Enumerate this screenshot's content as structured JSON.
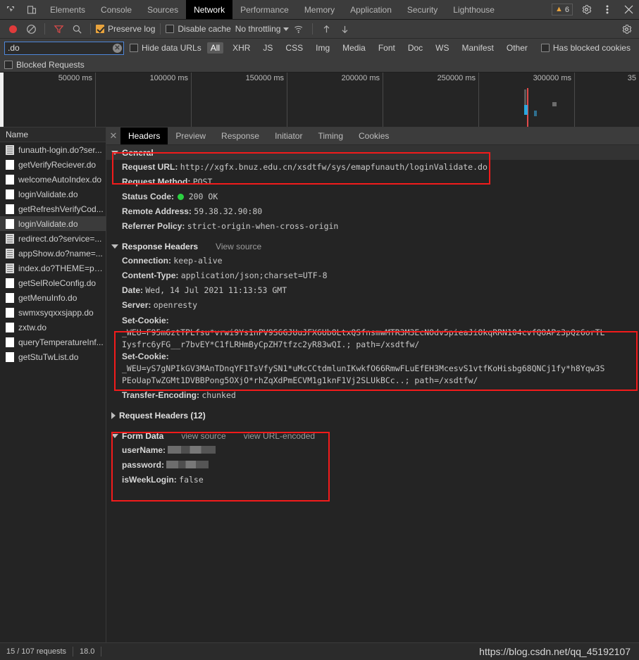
{
  "devtools": {
    "panel_tabs": [
      {
        "label": "Elements",
        "active": false
      },
      {
        "label": "Console",
        "active": false
      },
      {
        "label": "Sources",
        "active": false
      },
      {
        "label": "Network",
        "active": true
      },
      {
        "label": "Performance",
        "active": false
      },
      {
        "label": "Memory",
        "active": false
      },
      {
        "label": "Application",
        "active": false
      },
      {
        "label": "Security",
        "active": false
      },
      {
        "label": "Lighthouse",
        "active": false
      }
    ],
    "warning_count": "6",
    "icons": {
      "inspect": "inspect-element-icon",
      "device": "device-toolbar-icon",
      "settings": "gear-icon",
      "more": "kebab-menu-icon",
      "close": "close-icon"
    }
  },
  "toolbar": {
    "record_title": "record-button",
    "clear_title": "clear-button",
    "filter_title": "filter-button",
    "search_title": "search-button",
    "preserve_log_label": "Preserve log",
    "preserve_log_checked": true,
    "disable_cache_label": "Disable cache",
    "disable_cache_checked": false,
    "throttling_label": "No throttling",
    "wifi_title": "network-conditions-icon",
    "upload_title": "import-har-icon",
    "download_title": "export-har-icon",
    "settings_title": "network-settings-icon"
  },
  "filter_bar": {
    "filter_value": ".do",
    "filter_placeholder": "Filter",
    "hide_data_urls_label": "Hide data URLs",
    "hide_data_urls_checked": false,
    "types": [
      {
        "label": "All",
        "active": true
      },
      {
        "label": "XHR",
        "active": false
      },
      {
        "label": "JS",
        "active": false
      },
      {
        "label": "CSS",
        "active": false
      },
      {
        "label": "Img",
        "active": false
      },
      {
        "label": "Media",
        "active": false
      },
      {
        "label": "Font",
        "active": false
      },
      {
        "label": "Doc",
        "active": false
      },
      {
        "label": "WS",
        "active": false
      },
      {
        "label": "Manifest",
        "active": false
      },
      {
        "label": "Other",
        "active": false
      }
    ],
    "has_blocked_cookies_label": "Has blocked cookies",
    "has_blocked_cookies_checked": false,
    "blocked_requests_label": "Blocked Requests",
    "blocked_requests_checked": false
  },
  "overview": {
    "ticks": [
      "50000 ms",
      "100000 ms",
      "150000 ms",
      "200000 ms",
      "250000 ms",
      "300000 ms",
      "35"
    ]
  },
  "request_list": {
    "header": "Name",
    "rows": [
      {
        "name": "funauth-login.do?ser...",
        "type": "doc",
        "selected": false
      },
      {
        "name": "getVerifyReciever.do",
        "type": "xhr",
        "selected": false
      },
      {
        "name": "welcomeAutoIndex.do",
        "type": "xhr",
        "selected": false
      },
      {
        "name": "loginValidate.do",
        "type": "xhr",
        "selected": false
      },
      {
        "name": "getRefreshVerifyCod...",
        "type": "xhr",
        "selected": false
      },
      {
        "name": "loginValidate.do",
        "type": "xhr",
        "selected": true
      },
      {
        "name": "redirect.do?service=...",
        "type": "doc",
        "selected": false
      },
      {
        "name": "appShow.do?name=...",
        "type": "doc",
        "selected": false
      },
      {
        "name": "index.do?THEME=pu...",
        "type": "doc",
        "selected": false
      },
      {
        "name": "getSelRoleConfig.do",
        "type": "xhr",
        "selected": false
      },
      {
        "name": "getMenuInfo.do",
        "type": "xhr",
        "selected": false
      },
      {
        "name": "swmxsyqxxsjapp.do",
        "type": "xhr",
        "selected": false
      },
      {
        "name": "zxtw.do",
        "type": "xhr",
        "selected": false
      },
      {
        "name": "queryTemperatureInf...",
        "type": "xhr",
        "selected": false
      },
      {
        "name": "getStuTwList.do",
        "type": "xhr",
        "selected": false
      }
    ]
  },
  "detail_tabs": [
    {
      "label": "Headers",
      "active": true
    },
    {
      "label": "Preview",
      "active": false
    },
    {
      "label": "Response",
      "active": false
    },
    {
      "label": "Initiator",
      "active": false
    },
    {
      "label": "Timing",
      "active": false
    },
    {
      "label": "Cookies",
      "active": false
    }
  ],
  "headers": {
    "general": {
      "title": "General",
      "rows": [
        {
          "key": "Request URL:",
          "value": "http://xgfx.bnuz.edu.cn/xsdtfw/sys/emapfunauth/loginValidate.do"
        },
        {
          "key": "Request Method:",
          "value": "POST"
        },
        {
          "key": "Status Code:",
          "value": "200 OK",
          "status": true
        },
        {
          "key": "Remote Address:",
          "value": "59.38.32.90:80"
        },
        {
          "key": "Referrer Policy:",
          "value": "strict-origin-when-cross-origin"
        }
      ]
    },
    "response_headers": {
      "title": "Response Headers",
      "view_source": "View source",
      "rows": [
        {
          "key": "Connection:",
          "value": "keep-alive"
        },
        {
          "key": "Content-Type:",
          "value": "application/json;charset=UTF-8"
        },
        {
          "key": "Date:",
          "value": "Wed, 14 Jul 2021 11:13:53 GMT"
        },
        {
          "key": "Server:",
          "value": "openresty"
        }
      ],
      "set_cookie_1_key": "Set-Cookie:",
      "set_cookie_1_line1": "_WEU=F95m6ztTPLfsu*vrwi9Ys1nPV9S6GJUuJFX6UbOLtxQSfnsmwMTR3M3EcNOdv5pieaJiOkqRRN104cvfQOAPz3pQz6orTL",
      "set_cookie_1_line2": "Iysfrc6yFG__r7bvEY*C1fLRHmByCpZH7tfzc2yR83wQI.; path=/xsdtfw/",
      "set_cookie_2_key": "Set-Cookie:",
      "set_cookie_2_line1": "_WEU=yS7gNPIkGV3MAnTDnqYF1TsVfySN1*uMcCCtdmlunIKwkfO66RmwFLuEfEH3McesvS1vtfKoHisbg68QNCj1fy*h8Yqw3S",
      "set_cookie_2_line2": "PEoUapTwZGMt1DVBBPong5OXjO*rhZqXdPmECVM1g1knF1Vj2SLUkBCc..; path=/xsdtfw/",
      "transfer_encoding_key": "Transfer-Encoding:",
      "transfer_encoding_value": "chunked"
    },
    "request_headers": {
      "title": "Request Headers (12)"
    },
    "form_data": {
      "title": "Form Data",
      "view_source": "view source",
      "view_url_encoded": "view URL-encoded",
      "rows": [
        {
          "key": "userName:",
          "value": "",
          "redacted": true,
          "redact_width": 68
        },
        {
          "key": "password:",
          "value": "",
          "redacted": true,
          "redact_width": 60
        },
        {
          "key": "isWeekLogin:",
          "value": "false",
          "redacted": false
        }
      ]
    }
  },
  "statusbar": {
    "requests": "15 / 107 requests",
    "transferred": "18.0",
    "watermark": "https://blog.csdn.net/qq_45192107"
  },
  "colors": {
    "accent_red": "#f21b1b",
    "status_green": "#2bd141",
    "record_red": "#e03b3b",
    "checkbox_orange": "#e8a33d",
    "focus_blue": "#4e86d8"
  }
}
